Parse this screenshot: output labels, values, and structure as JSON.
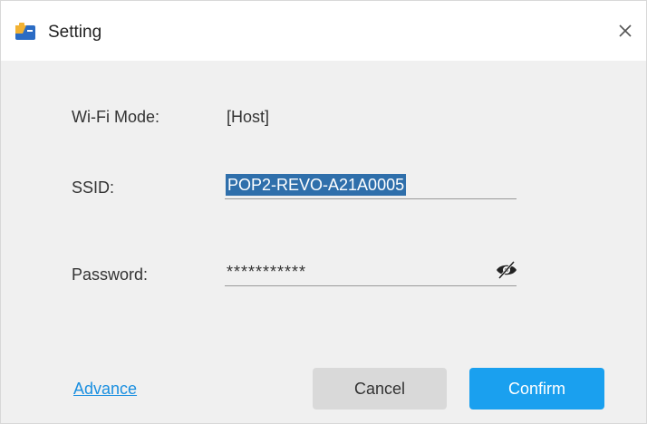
{
  "window": {
    "title": "Setting"
  },
  "form": {
    "wifi_mode_label": "Wi-Fi Mode:",
    "wifi_mode_value": "[Host]",
    "ssid_label": "SSID:",
    "ssid_value": "POP2-REVO-A21A0005",
    "password_label": "Password:",
    "password_value": "***********"
  },
  "footer": {
    "advance_label": "Advance",
    "cancel_label": "Cancel",
    "confirm_label": "Confirm"
  },
  "icons": {
    "app": "app-icon",
    "close": "close-icon",
    "visibility": "eye-hidden-icon"
  },
  "colors": {
    "accent": "#1aa0ef",
    "link": "#1a8fe0",
    "selection": "#2f6fab",
    "cancel_bg": "#d9d9d9"
  }
}
